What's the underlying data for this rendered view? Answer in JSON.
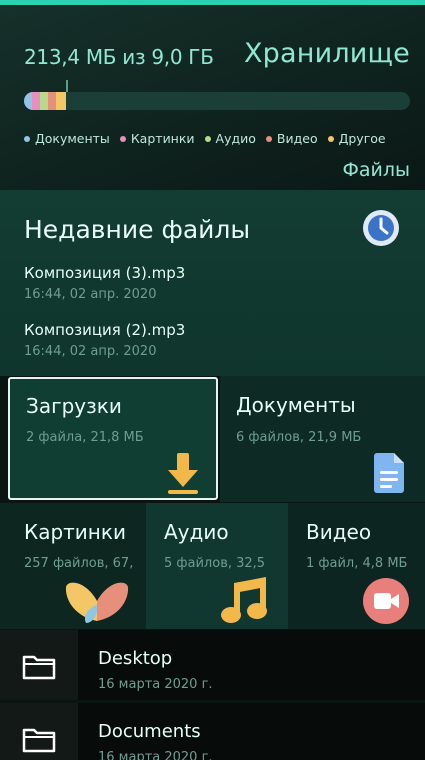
{
  "storage": {
    "usage_text": "213,4 МБ из 9,0 ГБ",
    "title": "Хранилище",
    "usage_segments": [
      {
        "name": "Документы",
        "color": "#8fc6e6",
        "fraction": 0.021
      },
      {
        "name": "Картинки",
        "color": "#e88fc0",
        "fraction": 0.021
      },
      {
        "name": "Аудио",
        "color": "#b8d98a",
        "fraction": 0.021
      },
      {
        "name": "Видео",
        "color": "#e68f7a",
        "fraction": 0.021
      },
      {
        "name": "Другое",
        "color": "#f3c766",
        "fraction": 0.026
      }
    ],
    "legend": [
      {
        "label": "Документы",
        "color": "#8fc6e6"
      },
      {
        "label": "Картинки",
        "color": "#e88fc0"
      },
      {
        "label": "Аудио",
        "color": "#b8d98a"
      },
      {
        "label": "Видео",
        "color": "#e68f7a"
      },
      {
        "label": "Другое",
        "color": "#f3c766"
      }
    ],
    "files_link": "Файлы"
  },
  "recent": {
    "title": "Недавние файлы",
    "icon": "clock-icon",
    "items": [
      {
        "name": "Композиция (3).mp3",
        "date": "16:44, 02 апр. 2020"
      },
      {
        "name": "Композиция (2).mp3",
        "date": "16:44, 02 апр. 2020"
      }
    ]
  },
  "tiles": {
    "downloads": {
      "title": "Загрузки",
      "subtitle": "2 файла, 21,8 МБ",
      "icon": "download-arrow-icon"
    },
    "documents": {
      "title": "Документы",
      "subtitle": "6 файлов, 21,9 МБ",
      "icon": "document-icon"
    },
    "pictures": {
      "title": "Картинки",
      "subtitle": "257 файлов, 67,",
      "icon": "butterfly-icon"
    },
    "audio": {
      "title": "Аудио",
      "subtitle": "5 файлов, 32,5",
      "icon": "music-note-icon"
    },
    "video": {
      "title": "Видео",
      "subtitle": "1 файл, 4,8 МБ",
      "icon": "video-camera-icon"
    }
  },
  "folders": [
    {
      "name": "Desktop",
      "date": "16 марта 2020 г.",
      "icon": "folder-icon"
    },
    {
      "name": "Documents",
      "date": "16 марта 2020 г.",
      "icon": "folder-icon"
    }
  ],
  "colors": {
    "accent": "#2bd1b0",
    "highlight_text": "#8fe8d2",
    "secondary_text": "#6f9d90"
  }
}
